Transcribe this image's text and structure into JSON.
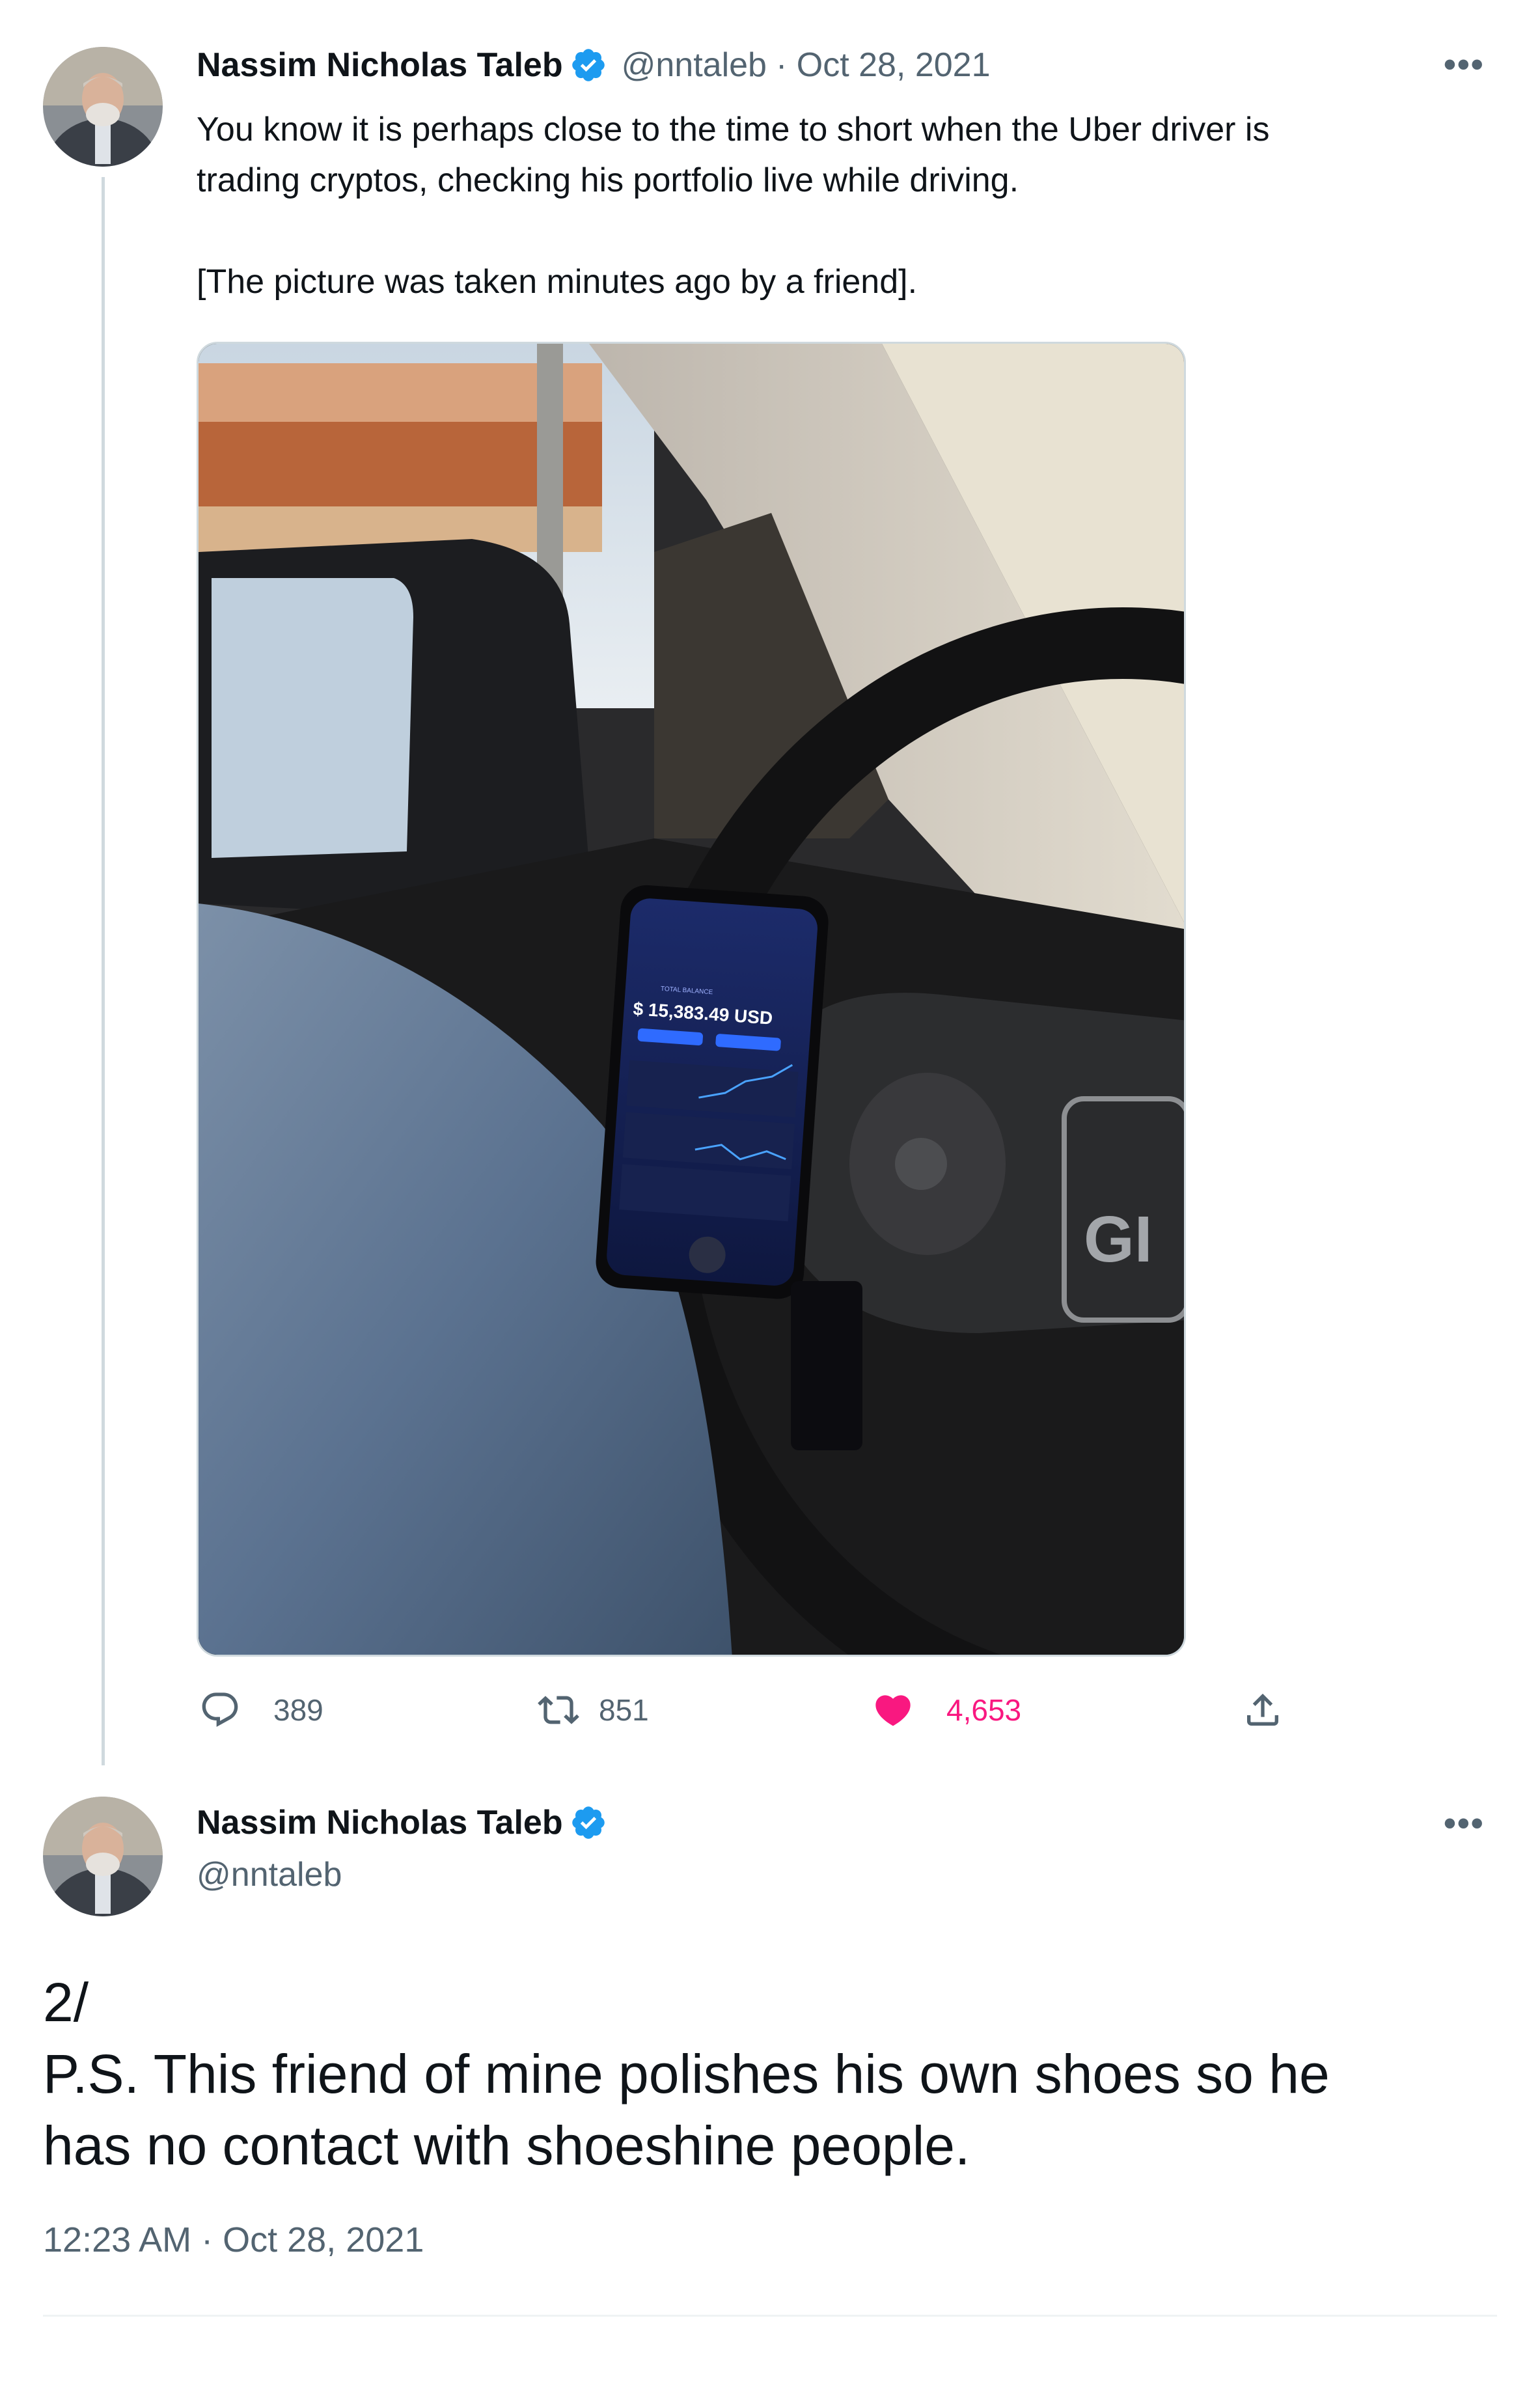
{
  "tweet1": {
    "author": {
      "display_name": "Nassim Nicholas Taleb",
      "handle": "@nntaleb",
      "verified": true
    },
    "date": "· Oct 28, 2021",
    "text_line1": "You know it is perhaps close to the time to short when the Uber driver is",
    "text_line2": "trading cryptos, checking his portfolio live while driving.",
    "text_line3": "[The picture was taken minutes ago by a friend].",
    "photo": {
      "phone_balance_label": "TOTAL BALANCE",
      "phone_balance": "$ 15,383.49 USD",
      "wheel_badge": "GI"
    },
    "stats": {
      "replies": "389",
      "retweets": "851",
      "likes": "4,653"
    },
    "more_icon": "ellipsis-icon"
  },
  "tweet2": {
    "author": {
      "display_name": "Nassim Nicholas Taleb",
      "handle": "@nntaleb",
      "verified": true
    },
    "text_line1": "2/",
    "text_line2": "P.S. This friend of mine polishes his own shoes so he",
    "text_line3": "has no contact with shoeshine people.",
    "timestamp": "12:23 AM · Oct 28, 2021"
  },
  "colors": {
    "verified_blue": "#1d9bf0",
    "like_pink": "#f91880",
    "secondary_text": "#536471"
  }
}
